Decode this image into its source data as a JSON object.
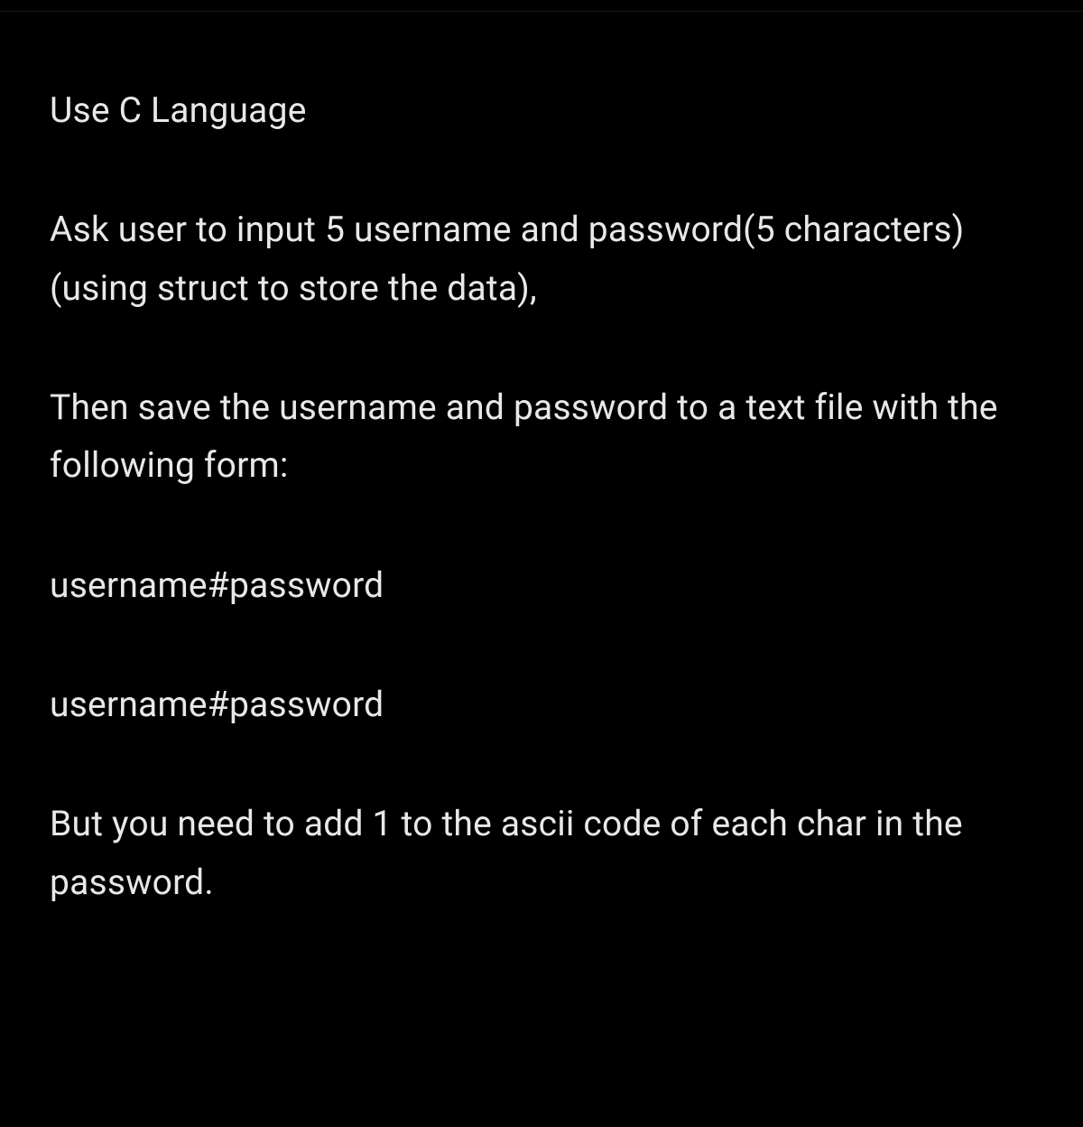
{
  "paragraphs": [
    "Use C Language",
    "Ask user to input 5 username and password(5 characters) (using struct to store the data),",
    "Then save the username and password to a text file with the following form:",
    "username#password",
    "username#password",
    "But you need to add 1 to the ascii code of each char in the password."
  ]
}
